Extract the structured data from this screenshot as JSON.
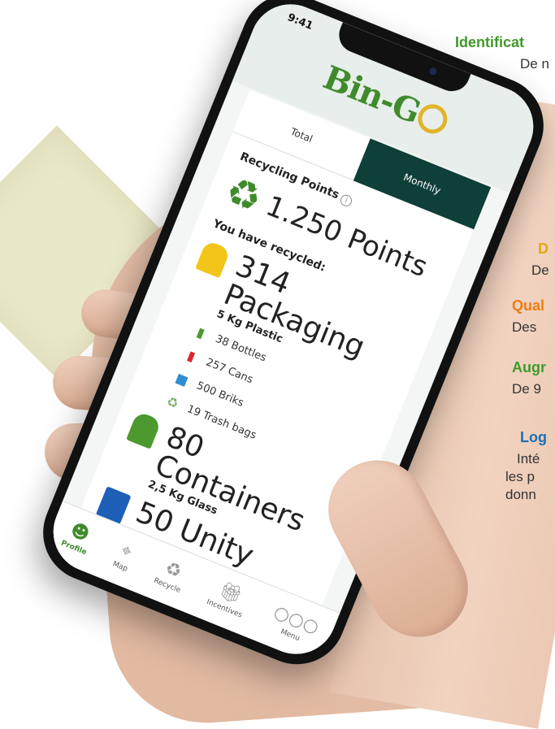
{
  "side_panel": [
    {
      "title": "Identificat",
      "text": "De n",
      "color": "#3f9b2a"
    },
    {
      "title": "D",
      "text": "De",
      "color": "#e1a614"
    },
    {
      "title": "Qual",
      "text": "Des",
      "color": "#f07d14"
    },
    {
      "title": "Augr",
      "text": "De 9",
      "color": "#3f9b2a"
    },
    {
      "title": "Log",
      "text": "Inté",
      "color": "#1b6fb3"
    }
  ],
  "side_extra": {
    "line2": "les p",
    "line3": "donn"
  },
  "status_bar": {
    "time": "9:41"
  },
  "app": {
    "logo": "Bin-G",
    "logo_ring_color": "#e1b42a"
  },
  "tabs": {
    "total": "Total",
    "monthly": "Monthly"
  },
  "recycling": {
    "label": "Recycling Points",
    "info_icon": "info-icon",
    "points": "1.250 Points",
    "recycled_label": "You have recycled:"
  },
  "categories": [
    {
      "name": "314 Packaging",
      "sub": "5 Kg Plastic",
      "bin_color": "#f2c518",
      "items": [
        {
          "label": "38 Bottles",
          "icon": "bottle-icon"
        },
        {
          "label": "257 Cans",
          "icon": "can-icon"
        },
        {
          "label": "500 Briks",
          "icon": "brik-icon"
        },
        {
          "label": "19 Trash bags",
          "icon": "trash-bag-icon"
        }
      ]
    },
    {
      "name": "80 Containers",
      "sub": "2,5 Kg Glass",
      "bin_color": "#4c9a2f"
    },
    {
      "name": "50 Unity",
      "sub": "",
      "bin_color": "#1e5fb8"
    }
  ],
  "nav": [
    {
      "label": "Profile",
      "icon": "profile-icon",
      "active": true
    },
    {
      "label": "Map",
      "icon": "map-icon",
      "active": false
    },
    {
      "label": "Recycle",
      "icon": "recycle-icon",
      "active": false
    },
    {
      "label": "Incentives",
      "icon": "gift-icon",
      "active": false
    },
    {
      "label": "Menu",
      "icon": "menu-icon",
      "active": false
    }
  ]
}
